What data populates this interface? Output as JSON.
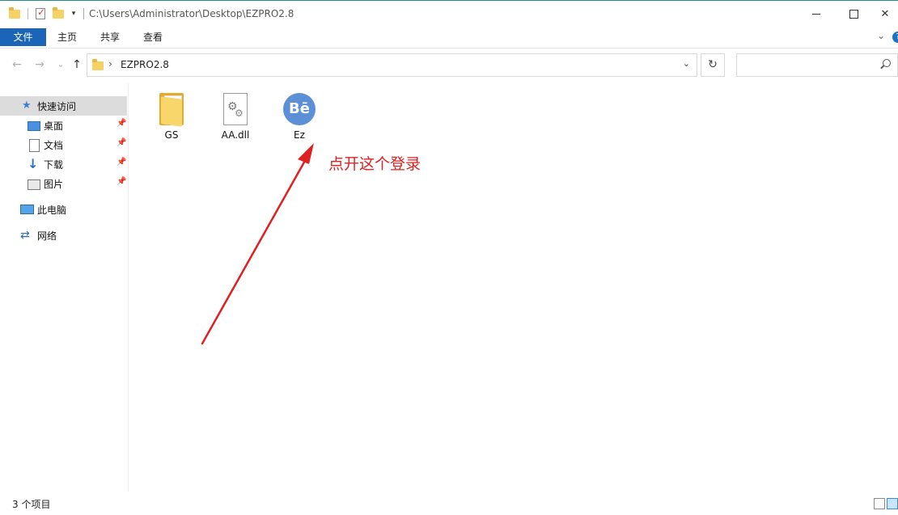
{
  "window": {
    "path_title": "C:\\Users\\Administrator\\Desktop\\EZPRO2.8",
    "close_glyph": "✕"
  },
  "ribbon": {
    "tabs": [
      {
        "label": "文件"
      },
      {
        "label": "主页"
      },
      {
        "label": "共享"
      },
      {
        "label": "查看"
      }
    ]
  },
  "nav": {
    "back_glyph": "←",
    "forward_glyph": "→",
    "recent_glyph": "⌄",
    "up_glyph": "↑",
    "breadcrumb_sep": "›",
    "address": "EZPRO2.8",
    "refresh_glyph": "↻",
    "search_placeholder": ""
  },
  "sidebar": {
    "items": [
      {
        "label": "快速访问",
        "icon": "star-icon",
        "pinned": false,
        "selected": true
      },
      {
        "label": "桌面",
        "icon": "desktop-icon",
        "pinned": true
      },
      {
        "label": "文档",
        "icon": "document-icon",
        "pinned": true
      },
      {
        "label": "下载",
        "icon": "download-icon",
        "pinned": true
      },
      {
        "label": "图片",
        "icon": "picture-icon",
        "pinned": true
      },
      {
        "label": "此电脑",
        "icon": "computer-icon",
        "pinned": false
      },
      {
        "label": "网络",
        "icon": "network-icon",
        "pinned": false
      }
    ],
    "pin_glyph": "📌"
  },
  "files": [
    {
      "name": "GS",
      "type": "folder"
    },
    {
      "name": "AA.dll",
      "type": "dll"
    },
    {
      "name": "Ez",
      "type": "application",
      "icon_text": "Bē"
    }
  ],
  "annotation": {
    "text": "点开这个登录",
    "color": "#e02020"
  },
  "status": {
    "item_count": "3 个项目"
  },
  "colors": {
    "file_tab": "#1a65b8",
    "selection": "#dcdcdc",
    "app_icon": "#5b8fd6"
  }
}
